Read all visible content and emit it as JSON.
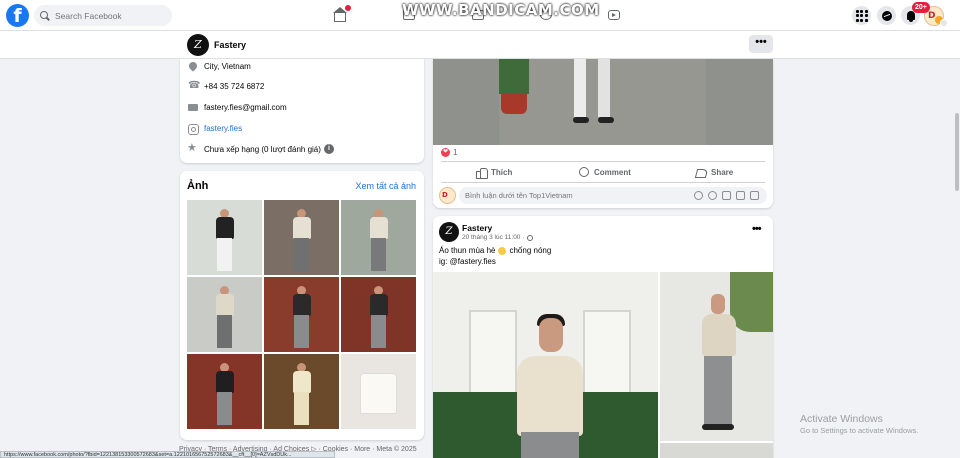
{
  "nav": {
    "logo": "f",
    "search_placeholder": "Search Facebook",
    "notifications_badge": "20+"
  },
  "watermark": "WWW.BANDICAM.COM",
  "page": {
    "name": "Fastery",
    "avatar_glyph": "Z",
    "more": "•••"
  },
  "intro": {
    "address": "City, Vietnam",
    "phone": "+84 35 724 6872",
    "email": "fastery.fies@gmail.com",
    "instagram": "fastery.fies",
    "rating": "Chưa xếp hạng (0 lượt đánh giá)",
    "info_icon": "i"
  },
  "photos": {
    "title": "Ảnh",
    "see_all": "Xem tất cả ảnh"
  },
  "footer": "Privacy · Terms · Advertising · Ad Choices ▷ · Cookies · More · Meta © 2025",
  "post1": {
    "reaction_count": "1",
    "like_label": "Thích",
    "comment_label": "Comment",
    "share_label": "Share",
    "comment_placeholder": "Bình luận dưới tên Top1Vietnam"
  },
  "post2": {
    "author": "Fastery",
    "time": "20 tháng 3 lúc 11:00 ·",
    "text1_before": "Áo thun mùa hè",
    "text1_after": "chống nóng",
    "text2": "ig: @fastery.fies",
    "more": "•••"
  },
  "status_url": "https://www.facebook.com/photo/?fbid=122138153300572683&set=a.122101656752572683&__cft__[0]=AZVsdDUk...",
  "windows": {
    "activate_title": "Activate Windows",
    "activate_sub": "Go to Settings to activate Windows."
  },
  "colors": {
    "brand": "#1877f2",
    "link": "#216fdb",
    "badge": "#e41e3f",
    "background": "#f0f2f5"
  },
  "icons": [
    "facebook-logo-icon",
    "search-icon",
    "home-icon",
    "video-icon",
    "marketplace-icon",
    "groups-icon",
    "gaming-icon",
    "menu-grid-icon",
    "messenger-icon",
    "bell-icon",
    "location-icon",
    "phone-icon",
    "mail-icon",
    "instagram-icon",
    "star-icon",
    "info-icon",
    "heart-icon",
    "like-icon",
    "comment-icon",
    "share-icon",
    "globe-icon",
    "sun-emoji-icon"
  ]
}
